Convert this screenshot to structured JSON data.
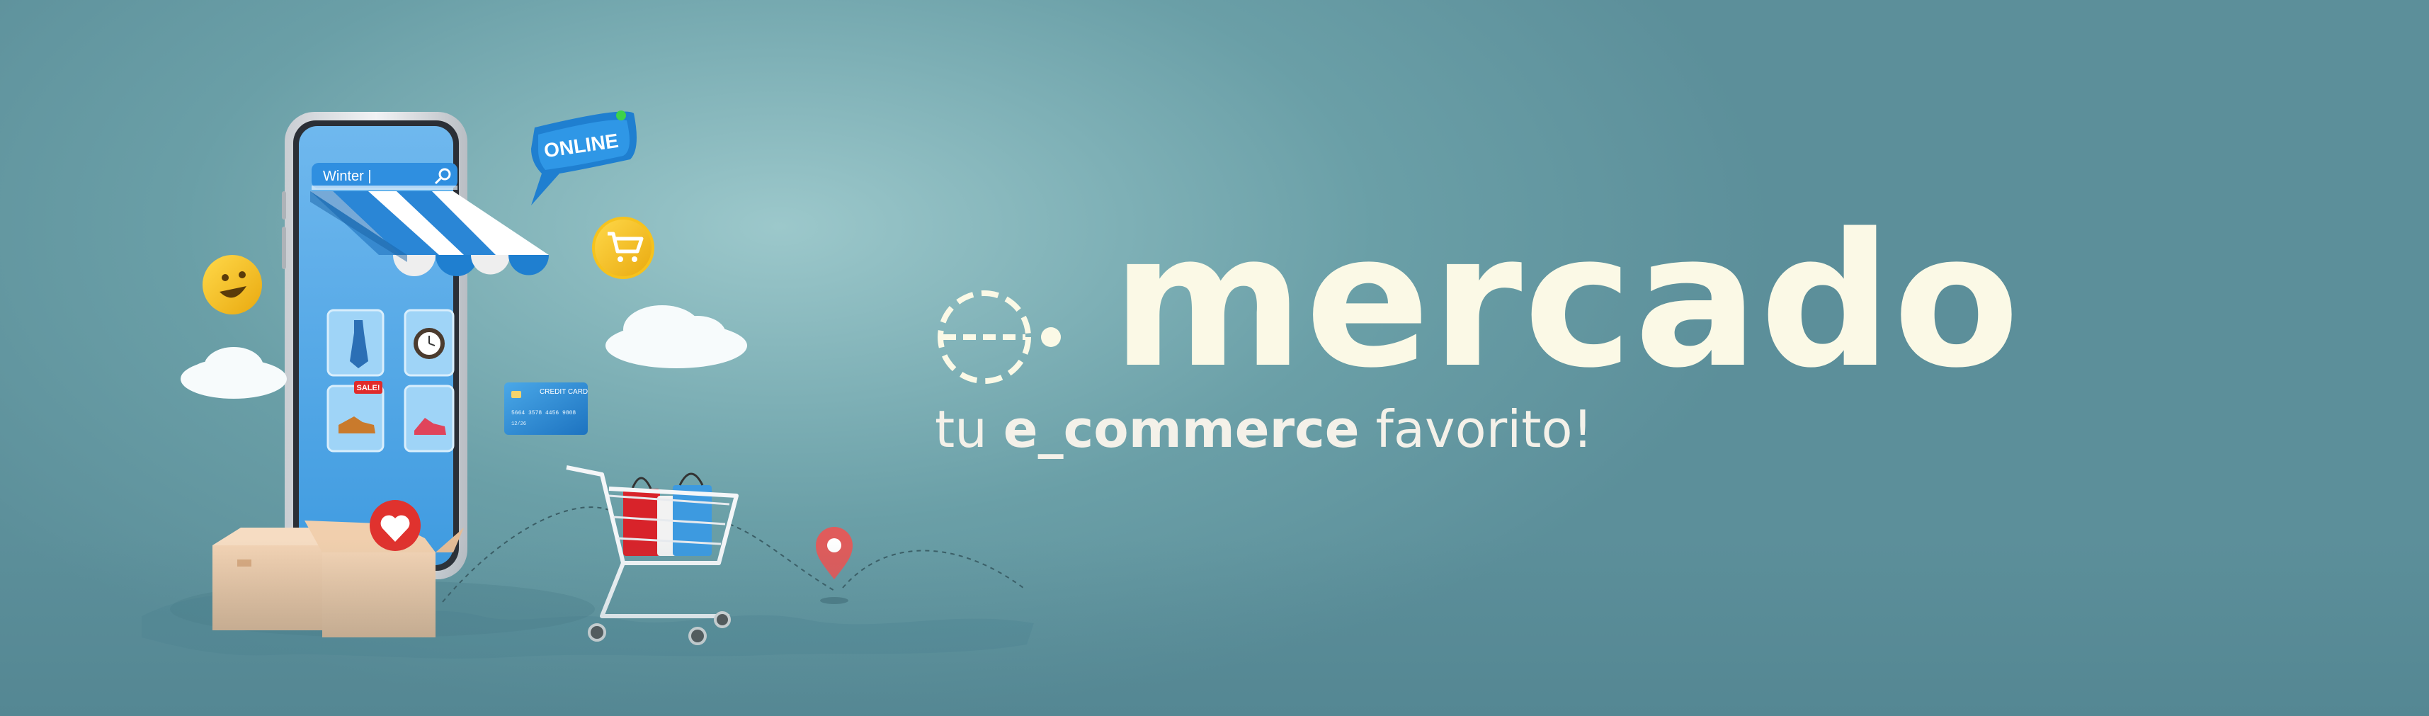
{
  "phone": {
    "search_value": "Winter |",
    "sale_label": "SALE!"
  },
  "chat_bubble": {
    "label": "ONLINE"
  },
  "credit_card": {
    "label": "CREDIT CARD",
    "number": "5664 3578 4456 9808",
    "expiry": "12/26"
  },
  "brand": {
    "name": "mercado",
    "tagline_prefix": "tu ",
    "tagline_highlight": "e_commerce",
    "tagline_suffix": " favorito!"
  },
  "icons": [
    "search-icon",
    "shopping-cart-icon",
    "heart-icon",
    "location-pin-icon",
    "smiley-icon"
  ],
  "colors": {
    "background": "#7eb0b6",
    "brand_text": "#fbf9e6",
    "awning_blue": "#1f7fd0",
    "heart_red": "#e0322e",
    "pin_red": "#e05b5b"
  }
}
